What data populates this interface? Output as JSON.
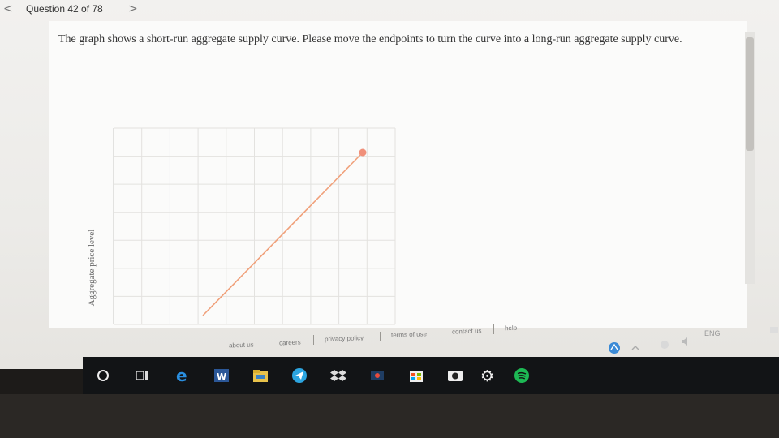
{
  "header": {
    "prev_glyph": "<",
    "next_glyph": ">",
    "question_counter": "Question 42 of 78"
  },
  "question": {
    "prompt": "The graph shows a short-run aggregate supply curve. Please move the endpoints to turn the curve into a long-run aggregate supply curve."
  },
  "graph": {
    "y_axis_label": "Aggregate price level",
    "curve_color": "#f0a07a",
    "endpoint_color": "#f0907a"
  },
  "footer": {
    "links": [
      "about us",
      "careers",
      "privacy policy",
      "terms of use",
      "contact us",
      "help"
    ]
  },
  "taskbar": {
    "icons": [
      "cortana-icon",
      "task-view-icon",
      "edge-icon",
      "word-icon",
      "file-explorer-icon",
      "telegram-icon",
      "dropbox-icon",
      "app-icon",
      "store-icon",
      "camera-icon",
      "settings-icon",
      "spotify-icon"
    ],
    "tray": {
      "language": "ENG"
    }
  }
}
